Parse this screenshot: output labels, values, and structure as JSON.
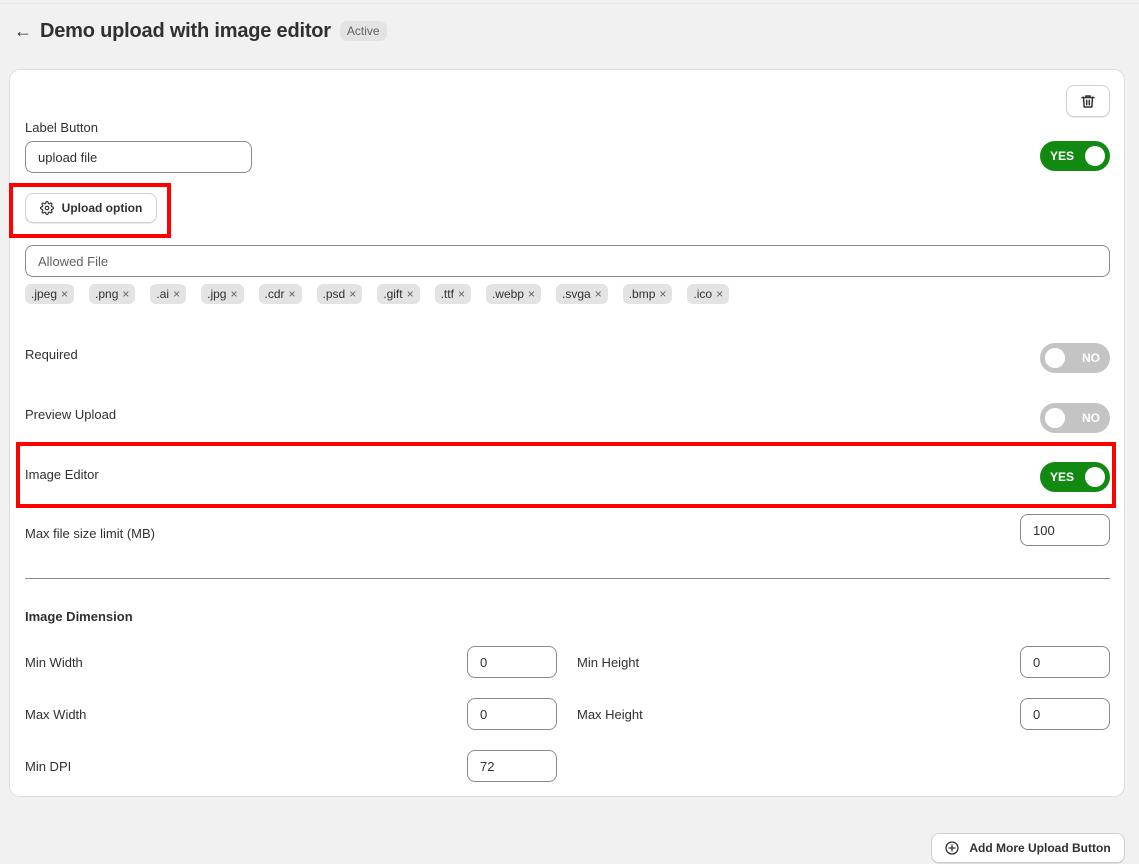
{
  "header": {
    "back_icon": "arrow-left-icon",
    "title": "Demo upload with image editor",
    "status": "Active"
  },
  "card": {
    "delete_icon": "trash-icon",
    "label_button": {
      "label": "Label Button",
      "value": "upload file",
      "toggle": "YES"
    },
    "upload_option": {
      "label": "Upload option",
      "icon": "gear-icon"
    },
    "allowed_file": {
      "placeholder": "Allowed File",
      "tags": [
        ".jpeg",
        ".png",
        ".ai",
        ".jpg",
        ".cdr",
        ".psd",
        ".gift",
        ".ttf",
        ".webp",
        ".svga",
        ".bmp",
        ".ico"
      ],
      "remove_icon": "×"
    },
    "required": {
      "label": "Required",
      "toggle": "NO"
    },
    "preview_upload": {
      "label": "Preview Upload",
      "toggle": "NO"
    },
    "image_editor": {
      "label": "Image Editor",
      "toggle": "YES"
    },
    "max_file_size": {
      "label": "Max file size limit (MB)",
      "value": "100"
    },
    "image_dimension": {
      "heading": "Image Dimension",
      "min_width": {
        "label": "Min Width",
        "value": "0"
      },
      "min_height": {
        "label": "Min Height",
        "value": "0"
      },
      "max_width": {
        "label": "Max Width",
        "value": "0"
      },
      "max_height": {
        "label": "Max Height",
        "value": "0"
      },
      "min_dpi": {
        "label": "Min DPI",
        "value": "72"
      }
    }
  },
  "footer": {
    "add_button": "Add More Upload Button",
    "add_icon": "plus-circle-icon"
  },
  "colors": {
    "toggle_on": "#128a12",
    "toggle_off": "#c4c4c4",
    "highlight": "#ff0000"
  }
}
